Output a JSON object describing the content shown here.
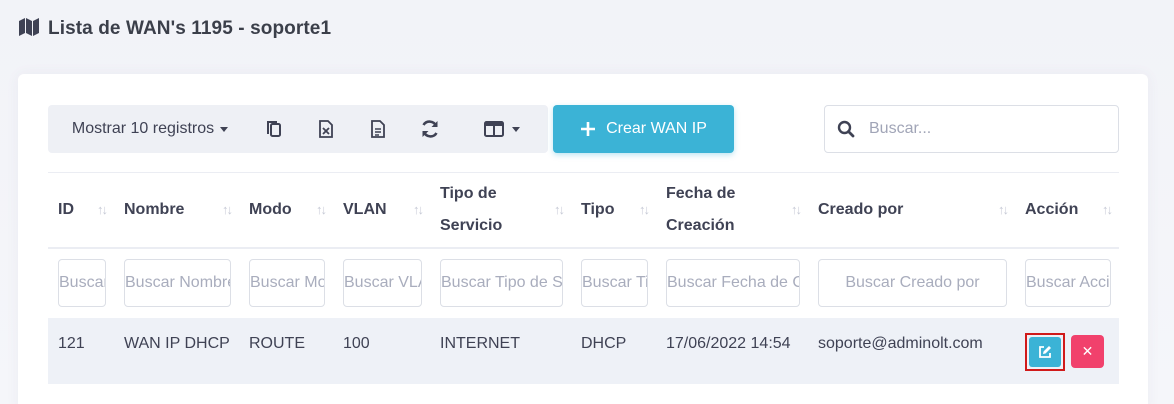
{
  "header": {
    "title": "Lista de WAN's 1195 - soporte1",
    "icon": "map-icon"
  },
  "toolbar": {
    "show_label": "Mostrar 10 registros",
    "copy_icon": "copy-icon",
    "excel_icon": "excel-icon",
    "pdf_icon": "document-icon",
    "refresh_icon": "refresh-icon",
    "columns_icon": "columns-icon",
    "create_label": "Crear WAN IP",
    "create_icon": "plus-icon"
  },
  "search": {
    "placeholder": "Buscar...",
    "icon": "search-icon"
  },
  "table": {
    "columns": [
      {
        "key": "id",
        "label": "ID",
        "filter_placeholder": "Buscar ID"
      },
      {
        "key": "nombre",
        "label": "Nombre",
        "filter_placeholder": "Buscar Nombre"
      },
      {
        "key": "modo",
        "label": "Modo",
        "filter_placeholder": "Buscar Modo"
      },
      {
        "key": "vlan",
        "label": "VLAN",
        "filter_placeholder": "Buscar VLAN"
      },
      {
        "key": "tipo_servicio",
        "label": "Tipo de Servicio",
        "filter_placeholder": "Buscar Tipo de Servicio"
      },
      {
        "key": "tipo",
        "label": "Tipo",
        "filter_placeholder": "Buscar Tipo"
      },
      {
        "key": "fecha",
        "label": "Fecha de Creación",
        "filter_placeholder": "Buscar Fecha de Creación"
      },
      {
        "key": "creado_por",
        "label": "Creado por",
        "filter_placeholder": "Buscar Creado por"
      },
      {
        "key": "accion",
        "label": "Acción",
        "filter_placeholder": "Buscar Acción"
      }
    ],
    "sort_glyph": "↑↓",
    "rows": [
      {
        "id": "121",
        "nombre": "WAN IP DHCP",
        "modo": "ROUTE",
        "vlan": "100",
        "tipo_servicio": "INTERNET",
        "tipo": "DHCP",
        "fecha": "17/06/2022 14:54",
        "creado_por": "soporte@adminolt.com",
        "actions": {
          "edit_icon": "edit-icon",
          "delete_icon": "close-icon",
          "delete_glyph": "✕"
        }
      }
    ]
  },
  "colors": {
    "primary": "#3bb3d6",
    "danger": "#f1416c",
    "highlight": "#d01a1a",
    "row_bg": "#eef1f7"
  }
}
